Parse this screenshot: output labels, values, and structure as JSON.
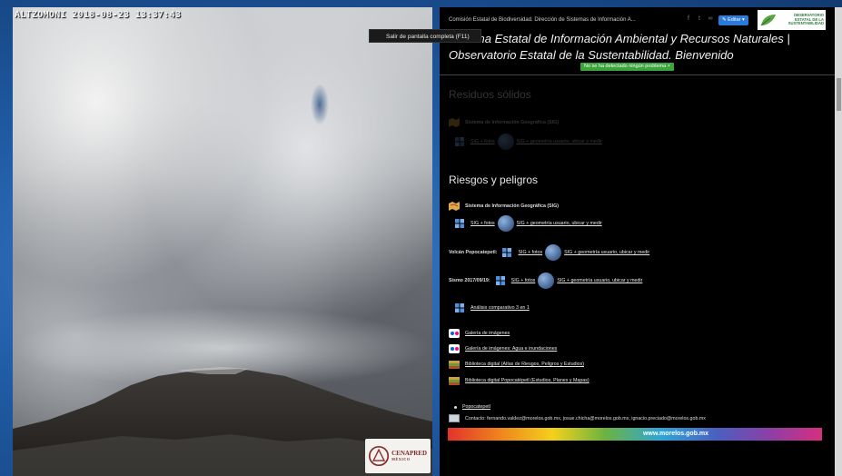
{
  "webcam": {
    "timestamp": "ALTZOMONI 2018-08-23 13:37:43",
    "cenapred_logo_text": "CENAPRED",
    "cenapred_logo_subtext": "MÉXICO"
  },
  "tooltip": {
    "fullscreen": "Salir de pantalla completa (F11)"
  },
  "site": {
    "breadcrumb": "Comisión Estatal de Biodiversidad. Dirección de Sistemas de Información A...",
    "edit_label": "✎ Editar ▾",
    "logo_text": "OBSERVATORIO ESTATAL DE LA SUSTENTABILIDAD",
    "title": "Sistema Estatal de Información Ambiental y Recursos Naturales | Observatorio Estatal de la Sustentabilidad. Bienvenido",
    "status_badge": "No se ha detectado ningún problema ×"
  },
  "residuos": {
    "title": "Residuos sólidos",
    "sig": "Sistema de Información Geográfica (SIG)",
    "sig_fotos": "SIG + fotos",
    "sig_geometria": "SIG + geometría usuario, ubicar y medir"
  },
  "riesgos": {
    "title": "Riesgos y peligros",
    "sig": "Sistema de Información Geográfica (SIG)",
    "sig_fotos": "SIG + fotos",
    "sig_geometria": "SIG + geometría usuario, ubicar y medir",
    "volcan_label": "Volcán Popocatepetl:",
    "volcan_fotos": "SIG + fotos",
    "volcan_geometria": "SIG + geometría usuario, ubicar y medir",
    "sismo_label": "Sismo 2017/09/19:",
    "sismo_fotos": "SIG + fotos",
    "sismo_geometria": "SIG + geometría usuario, ubicar y medir",
    "analisis": "Análisis comparativo 3 en 1",
    "galeria": "Galería de imágenes",
    "galeria_agua": "Galería de imágenes: Agua e inundaciones",
    "biblioteca_atlas": "Biblioteca digital (Atlas de Riesgos, Peligros y Estudios)",
    "biblioteca_popo": "Biblioteca digital Popocatépetl (Estudios, Planes y Mapas)",
    "popocatepetl": "Popocatepetl",
    "contacto": "Contacto: fernando.valdez@morelos.gob.mx, josue.chicha@morelos.gob.mx, ignacio.preciado@morelos.gob.mx"
  },
  "footer": {
    "banner": "www.morelos.gob.mx"
  }
}
